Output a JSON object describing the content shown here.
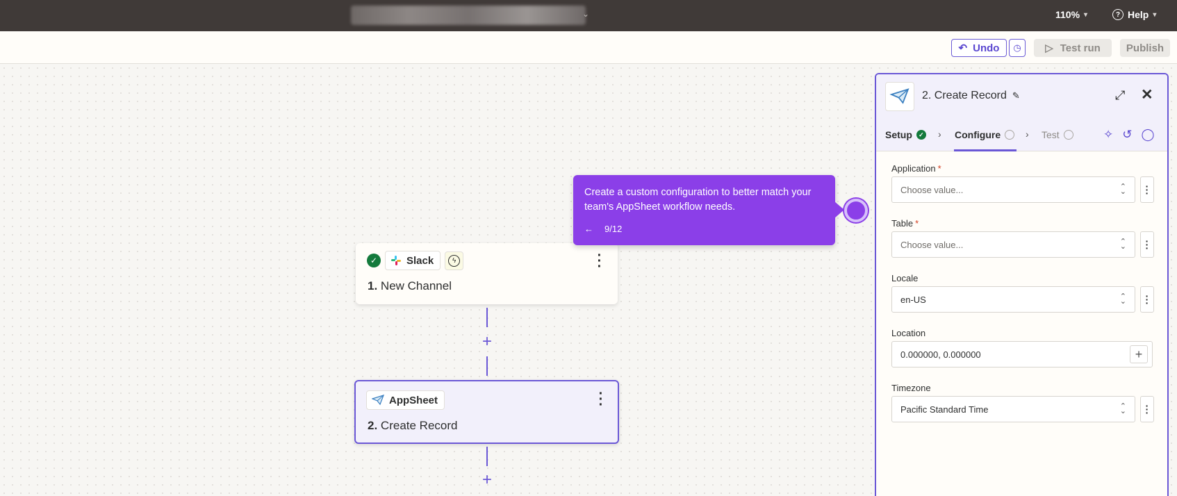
{
  "topbar": {
    "zoom": "110%",
    "help": "Help",
    "zoom_icon": "chevron-down-icon",
    "help_icon": "question-circle-icon"
  },
  "toolbar": {
    "undo": "Undo",
    "test_run": "Test run",
    "publish": "Publish"
  },
  "nodes": [
    {
      "app": "Slack",
      "step_num": "1.",
      "step_title": "New Channel"
    },
    {
      "app": "AppSheet",
      "step_num": "2.",
      "step_title": "Create Record"
    }
  ],
  "tooltip": {
    "text": "Create a custom configuration to better match your team's AppSheet workflow needs.",
    "progress": "9/12"
  },
  "panel": {
    "title": "2. Create Record",
    "tabs": {
      "setup": "Setup",
      "configure": "Configure",
      "test": "Test"
    },
    "fields": {
      "application": {
        "label": "Application",
        "required": "*",
        "placeholder": "Choose value..."
      },
      "table": {
        "label": "Table",
        "required": "*",
        "placeholder": "Choose value..."
      },
      "locale": {
        "label": "Locale",
        "value": "en-US"
      },
      "location": {
        "label": "Location",
        "value": "0.000000, 0.000000"
      },
      "timezone": {
        "label": "Timezone",
        "value": "Pacific Standard Time"
      }
    }
  },
  "colors": {
    "accent": "#6a57d6",
    "tooltip": "#8b3fe8",
    "success": "#147a3c",
    "topbar": "#403a38"
  }
}
